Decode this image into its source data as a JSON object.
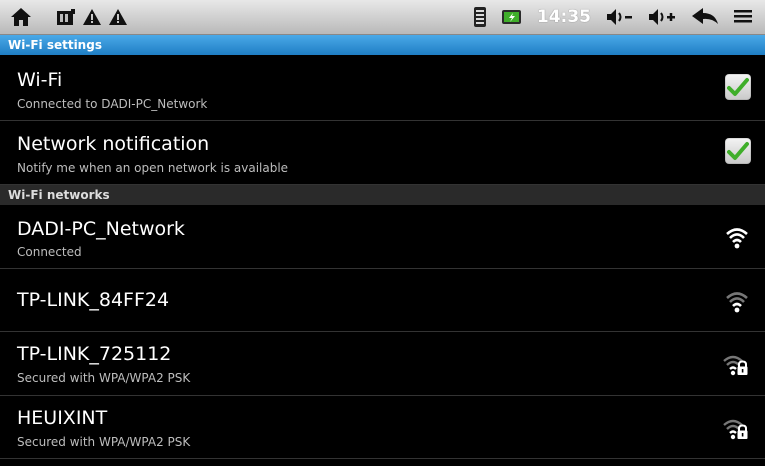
{
  "status_bar": {
    "time": "14:35",
    "icons": [
      "home-icon",
      "sd-card-icon",
      "warning-icon",
      "warning-icon",
      "wifi-signal-icon",
      "battery-icon",
      "volume-down-icon",
      "volume-up-icon",
      "back-icon",
      "menu-icon"
    ]
  },
  "sections": {
    "wifi_settings": "Wi-Fi settings",
    "wifi_networks": "Wi-Fi networks"
  },
  "settings": [
    {
      "title": "Wi-Fi",
      "summary": "Connected to DADI-PC_Network",
      "checked": true
    },
    {
      "title": "Network notification",
      "summary": "Notify me when an open network is available",
      "checked": true
    }
  ],
  "networks": [
    {
      "name": "DADI-PC_Network",
      "status": "Connected",
      "secured": false,
      "signal": "strong"
    },
    {
      "name": "TP-LINK_84FF24",
      "status": "",
      "secured": false,
      "signal": "weak"
    },
    {
      "name": "TP-LINK_725112",
      "status": "Secured with WPA/WPA2 PSK",
      "secured": true,
      "signal": "weak"
    },
    {
      "name": "HEUIXINT",
      "status": "Secured with WPA/WPA2 PSK",
      "secured": true,
      "signal": "weak"
    }
  ],
  "colors": {
    "header_blue": "#2d8fd5",
    "check_green": "#3fae2a"
  }
}
